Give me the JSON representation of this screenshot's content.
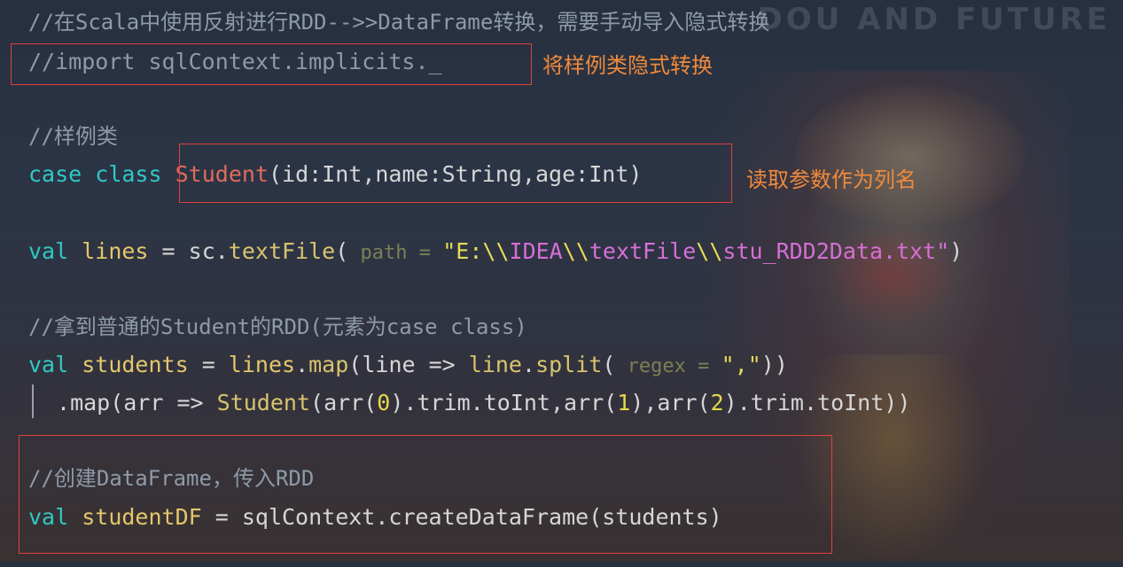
{
  "watermark": "DOU      AND  FUTURE",
  "code": {
    "line1_comment": "//在Scala中使用反射进行RDD-->>DataFrame转换，需要手动导入隐式转换",
    "line2_comment": "//import sqlContext.implicits._",
    "line4_comment": "//样例类",
    "line5": {
      "kw_case": "case",
      "kw_class": "class",
      "cls": "Student",
      "params": "(id:Int,name:String,age:Int)"
    },
    "line7": {
      "kw": "val",
      "var": "lines",
      "eq": " = sc.",
      "fn": "textFile",
      "open": "(",
      "hint": " path = ",
      "str1": "\"E:",
      "esc1": "\\\\",
      "str2": "IDEA",
      "esc2": "\\\\",
      "str3": "textFile",
      "esc3": "\\\\",
      "str4": "stu_RDD2Data.txt\"",
      "close": ")"
    },
    "line9_comment": "//拿到普通的Student的RDD(元素为case class)",
    "line10": {
      "kw": "val",
      "var": "students",
      "eq": " = ",
      "lines": "lines",
      "dot": ".",
      "fn1": "map",
      "open": "(",
      "param": "line",
      "arrow": " => ",
      "line2": "line",
      "dot2": ".",
      "fn2": "split",
      "open2": "(",
      "hint": " regex = ",
      "str": "\",\"",
      "close": "))"
    },
    "line11": {
      "dot": ".",
      "fn1": "map",
      "open": "(",
      "param": "arr",
      "arrow": " => ",
      "cls": "Student",
      "p1": "(arr(",
      "n0": "0",
      "p2": ").trim.",
      "fn2": "toInt",
      "p3": ",arr(",
      "n1": "1",
      "p4": "),arr(",
      "n2": "2",
      "p5": ").trim.",
      "fn3": "toInt",
      "p6": "))"
    },
    "line13_comment": "//创建DataFrame，传入RDD",
    "line14": {
      "kw": "val",
      "var": "studentDF",
      "eq": " = sqlContext.",
      "fn": "createDataFrame",
      "args": "(students)"
    }
  },
  "annotations": {
    "implicits": "将样例类隐式转换",
    "column_names": "读取参数作为列名"
  },
  "colors": {
    "comment": "#8e9aa8",
    "keyword": "#2fc9c4",
    "variable": "#e4c76a",
    "class": "#e06c5a",
    "string": "#d76fd6",
    "annotation": "#ef8a3c",
    "box": "#e0413a"
  }
}
